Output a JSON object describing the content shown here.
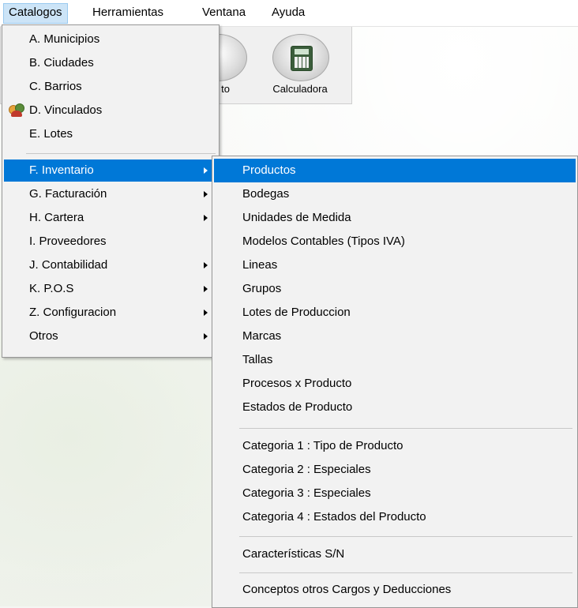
{
  "menubar": {
    "items": [
      {
        "label": "Catalogos"
      },
      {
        "label": "Herramientas"
      },
      {
        "label": "Ventana"
      },
      {
        "label": "Ayuda"
      }
    ]
  },
  "toolbar": {
    "buttons": [
      {
        "label": "to"
      },
      {
        "label": "Calculadora",
        "icon": "calculator-icon"
      }
    ]
  },
  "catalogos_menu": {
    "items": [
      {
        "label": "A. Municipios"
      },
      {
        "label": "B. Ciudades"
      },
      {
        "label": "C. Barrios"
      },
      {
        "label": "D. Vinculados",
        "icon": "people-icon"
      },
      {
        "label": "E. Lotes"
      },
      {
        "label": "F.  Inventario",
        "submenu": true,
        "selected": true
      },
      {
        "label": "G. Facturación",
        "submenu": true
      },
      {
        "label": "H. Cartera",
        "submenu": true
      },
      {
        "label": "I.  Proveedores"
      },
      {
        "label": "J. Contabilidad",
        "submenu": true
      },
      {
        "label": "K. P.O.S",
        "submenu": true
      },
      {
        "label": "Z. Configuracion",
        "submenu": true
      },
      {
        "label": "Otros",
        "submenu": true
      }
    ]
  },
  "inventario_submenu": {
    "items": [
      {
        "label": "Productos",
        "selected": true
      },
      {
        "label": "Bodegas"
      },
      {
        "label": "Unidades de Medida"
      },
      {
        "label": "Modelos Contables (Tipos IVA)"
      },
      {
        "label": "Lineas"
      },
      {
        "label": "Grupos"
      },
      {
        "label": "Lotes de Produccion"
      },
      {
        "label": "Marcas"
      },
      {
        "label": "Tallas"
      },
      {
        "label": "Procesos x Producto"
      },
      {
        "label": "Estados de Producto"
      },
      {
        "label": "Categoria 1 : Tipo de Producto"
      },
      {
        "label": "Categoria 2 : Especiales"
      },
      {
        "label": "Categoria 3 : Especiales"
      },
      {
        "label": "Categoria 4 : Estados del Producto"
      },
      {
        "label": "Características S/N"
      },
      {
        "label": "Conceptos otros Cargos y Deducciones"
      }
    ]
  },
  "colors": {
    "selection": "#0078d7",
    "menu_bg": "#f2f2f2",
    "menubar_active": "#cce4f7"
  }
}
